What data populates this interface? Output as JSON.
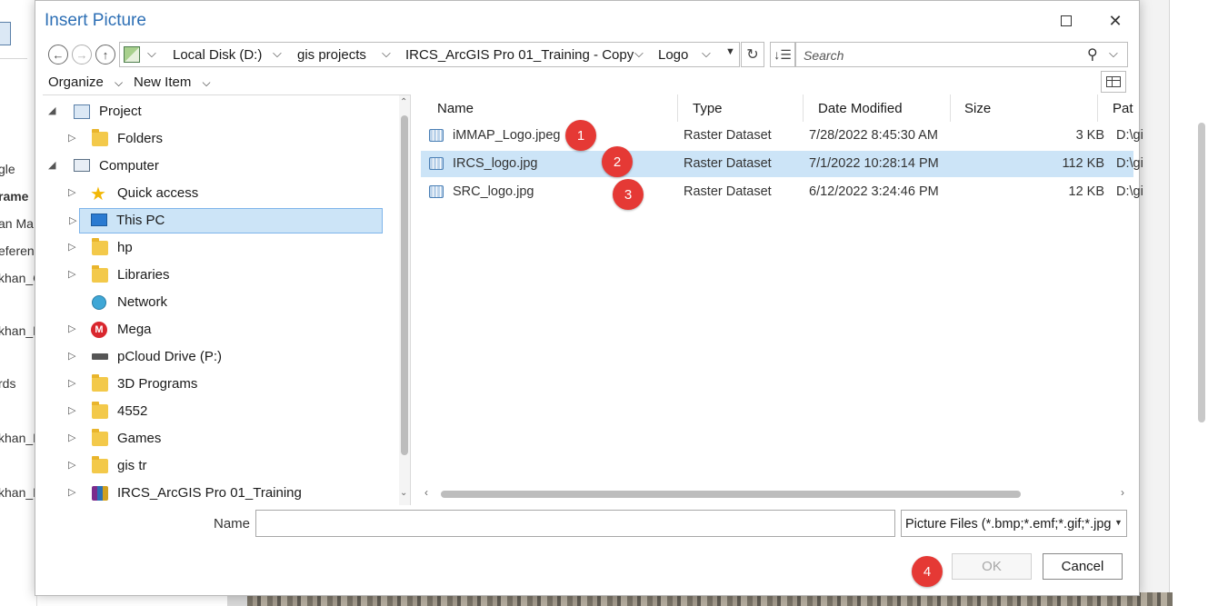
{
  "background": {
    "left_texts": [
      "gle",
      "rame",
      "an Ma",
      "eferen",
      "khan_C",
      "khan_F",
      "rds",
      "khan_L",
      "khan_F"
    ]
  },
  "dialog": {
    "title": "Insert Picture",
    "maximize_glyph": "☐",
    "close_glyph": "✕"
  },
  "address_bar": {
    "breadcrumbs": [
      "Local Disk (D:)",
      "gis projects",
      "IRCS_ArcGIS Pro 01_Training - Copy",
      "Logo"
    ]
  },
  "search": {
    "placeholder": "Search"
  },
  "toolbar": {
    "organize": "Organize",
    "new_item": "New Item"
  },
  "tree": {
    "items": [
      {
        "label": "Project",
        "icon": "project-icon",
        "expanded": true
      },
      {
        "label": "Folders",
        "icon": "folder-icon"
      },
      {
        "label": "Computer",
        "icon": "computer-icon",
        "expanded": true
      },
      {
        "label": "Quick access",
        "icon": "star-icon"
      },
      {
        "label": "This PC",
        "icon": "monitor-icon",
        "selected": true
      },
      {
        "label": "hp",
        "icon": "folder-icon"
      },
      {
        "label": "Libraries",
        "icon": "folder-icon"
      },
      {
        "label": "Network",
        "icon": "network-icon"
      },
      {
        "label": "Mega",
        "icon": "mega-icon"
      },
      {
        "label": "pCloud Drive (P:)",
        "icon": "drive-icon"
      },
      {
        "label": "3D Programs",
        "icon": "folder-icon"
      },
      {
        "label": "4552",
        "icon": "folder-icon"
      },
      {
        "label": "Games",
        "icon": "folder-icon"
      },
      {
        "label": "gis tr",
        "icon": "folder-icon"
      },
      {
        "label": "IRCS_ArcGIS Pro 01_Training",
        "icon": "archive-icon"
      }
    ]
  },
  "file_list": {
    "columns": [
      "Name",
      "Type",
      "Date Modified",
      "Size",
      "Pat"
    ],
    "rows": [
      {
        "name": "iMMAP_Logo.jpeg",
        "type": "Raster Dataset",
        "date": "7/28/2022 8:45:30 AM",
        "size": "3 KB",
        "path": "D:\\gi"
      },
      {
        "name": "IRCS_logo.jpg",
        "type": "Raster Dataset",
        "date": "7/1/2022 10:28:14 PM",
        "size": "112 KB",
        "path": "D:\\gi",
        "selected": true
      },
      {
        "name": "SRC_logo.jpg",
        "type": "Raster Dataset",
        "date": "6/12/2022 3:24:46 PM",
        "size": "12 KB",
        "path": "D:\\gi"
      }
    ]
  },
  "annotations": [
    "1",
    "2",
    "3",
    "4"
  ],
  "bottom": {
    "name_label": "Name",
    "name_value": "",
    "file_type": "Picture Files (*.bmp;*.emf;*.gif;*.jpg",
    "ok_label": "OK",
    "cancel_label": "Cancel"
  },
  "colors": {
    "title": "#2d6fb5",
    "selection": "#cce4f7",
    "badge": "#e53935"
  }
}
